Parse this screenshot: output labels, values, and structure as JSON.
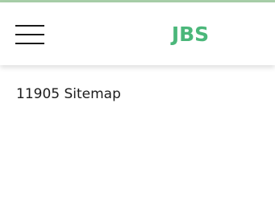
{
  "header": {
    "menu_icon": "hamburger-menu-icon",
    "logo_text": "JBS",
    "logo_color": "#4bb77a",
    "accent_color": "#a8cfa9"
  },
  "main": {
    "title": "11905 Sitemap"
  }
}
